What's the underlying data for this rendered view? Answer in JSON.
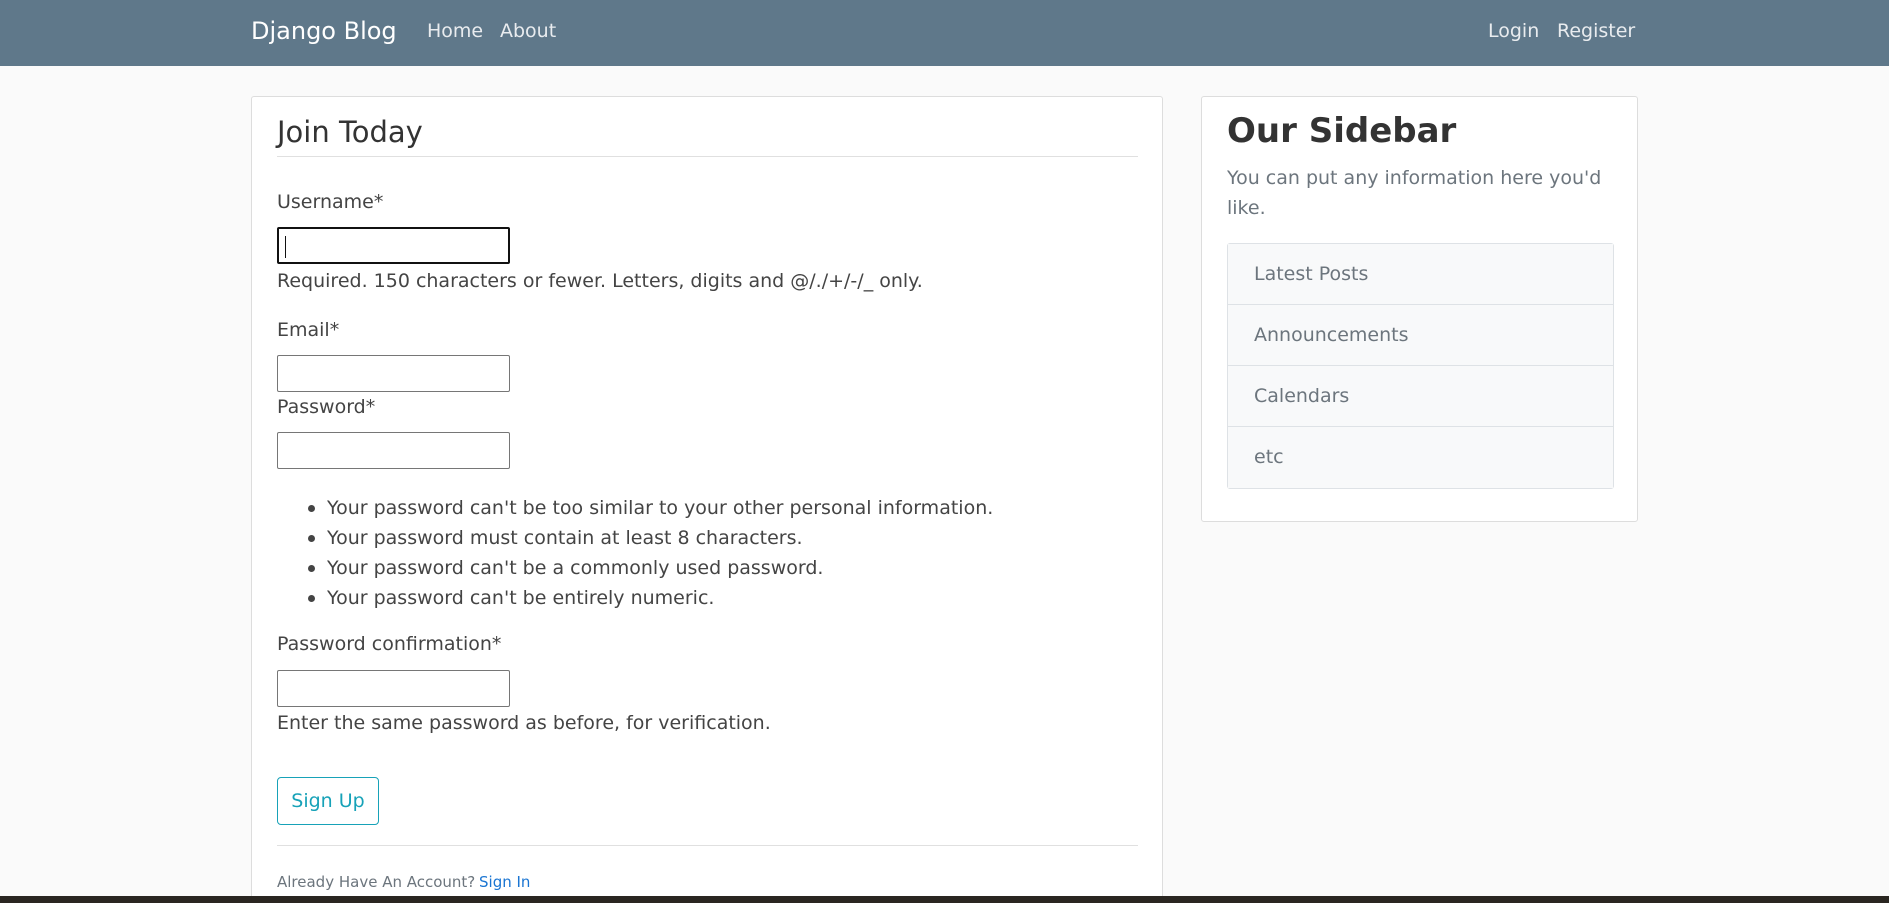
{
  "nav": {
    "brand": "Django Blog",
    "links": [
      "Home",
      "About"
    ],
    "auth_links": [
      "Login",
      "Register"
    ]
  },
  "form": {
    "title": "Join Today",
    "username": {
      "label": "Username*",
      "value": "",
      "help": "Required. 150 characters or fewer. Letters, digits and @/./+/-/_ only."
    },
    "email": {
      "label": "Email*",
      "value": ""
    },
    "password": {
      "label": "Password*",
      "value": "",
      "rules": [
        "Your password can't be too similar to your other personal information.",
        "Your password must contain at least 8 characters.",
        "Your password can't be a commonly used password.",
        "Your password can't be entirely numeric."
      ]
    },
    "password_confirmation": {
      "label": "Password confirmation*",
      "value": "",
      "help": "Enter the same password as before, for verification."
    },
    "submit_label": "Sign Up",
    "footer_text": "Already Have An Account?",
    "signin_label": "Sign In"
  },
  "sidebar": {
    "title": "Our Sidebar",
    "text": "You can put any information here you'd like.",
    "items": [
      "Latest Posts",
      "Announcements",
      "Calendars",
      "etc"
    ]
  },
  "colors": {
    "navbar": "#5f788a",
    "accent": "#17a2b8",
    "link": "#1a75d2"
  }
}
